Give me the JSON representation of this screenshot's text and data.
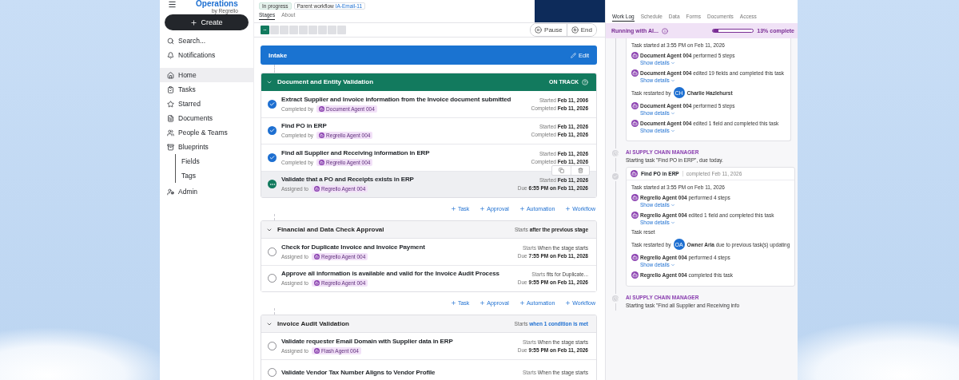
{
  "sidebar": {
    "logo": {
      "title": "Operations",
      "byline": "by Regrello"
    },
    "create_button": "Create",
    "top_items": [
      {
        "label": "Search..."
      },
      {
        "label": "Notifications"
      }
    ],
    "items": [
      {
        "label": "Home",
        "selected": true
      },
      {
        "label": "Tasks",
        "selected": false
      },
      {
        "label": "Starred",
        "selected": false
      },
      {
        "label": "Documents",
        "selected": false
      },
      {
        "label": "People & Teams",
        "selected": false
      },
      {
        "label": "Blueprints",
        "selected": false,
        "children": [
          {
            "label": "Fields",
            "selected": false
          },
          {
            "label": "Tags",
            "selected": false
          }
        ]
      },
      {
        "label": "Admin",
        "selected": false
      }
    ]
  },
  "header": {
    "badges": [
      {
        "kind": "status",
        "text": "In progress"
      },
      {
        "kind": "parent",
        "text": "Parent workflow",
        "link": "IA-Email-11"
      }
    ],
    "tabs": [
      {
        "label": "Stages",
        "selected": true
      },
      {
        "label": "About",
        "selected": false
      }
    ],
    "stage_steps": [
      {
        "selected": true
      },
      {
        "selected": false
      },
      {
        "selected": false
      },
      {
        "selected": false
      },
      {
        "selected": false
      },
      {
        "selected": false
      },
      {
        "selected": false
      },
      {
        "selected": false
      },
      {
        "selected": false
      }
    ],
    "buttons": [
      {
        "kind": "pause",
        "label": "Pause"
      },
      {
        "kind": "end",
        "label": "End"
      }
    ]
  },
  "intake": {
    "title": "Intake",
    "edit": "Edit"
  },
  "stages": [
    {
      "title": "Document and Entity Validation",
      "active": true,
      "badge": "ON TRACK",
      "add_actions": [
        "Task",
        "Approval",
        "Automation",
        "Workflow"
      ],
      "tasks": [
        {
          "title": "Extract Supplier and Invoice information from the Invoice document submitted",
          "kind": "check",
          "checked": true,
          "hovered": false,
          "who_label": "Completed by",
          "agent": "Document Agent 004",
          "line1_label": "Started",
          "line1_value": "Feb 11, 2006",
          "line2_label": "Completed",
          "line2_value": "Feb 11, 2026"
        },
        {
          "title": "Find PO in ERP",
          "kind": "check",
          "checked": true,
          "hovered": false,
          "who_label": "Completed by",
          "agent": "Regrello Agent 004",
          "line1_label": "Started",
          "line1_value": "Feb 11, 2026",
          "line2_label": "Completed",
          "line2_value": "Feb 11, 2026"
        },
        {
          "title": "Find all Supplier and Receiving information in ERP",
          "kind": "check",
          "checked": true,
          "hovered": false,
          "who_label": "Completed by",
          "agent": "Regrello Agent 004",
          "line1_label": "Started",
          "line1_value": "Feb 11, 2026",
          "line2_label": "Completed",
          "line2_value": "Feb 11, 2026"
        },
        {
          "title": "Validate that a PO and Receipts exists in ERP",
          "kind": "progress",
          "hovered": true,
          "who_label": "Assigned to",
          "agent": "Regrello Agent 004",
          "line1_label": "Started",
          "line1_value": "Feb 11, 2026",
          "line2_label": "Due",
          "line2_value": "6:55 PM on Feb 11, 2026"
        }
      ]
    },
    {
      "title": "Financial and Data Check Approval",
      "active": false,
      "starts": {
        "label": "Starts",
        "value": "after the previous stage",
        "link": false
      },
      "add_actions": [
        "Task",
        "Approval",
        "Automation",
        "Workflow"
      ],
      "tasks": [
        {
          "title": "Check for Duplicate Invoice and Invoice Payment",
          "kind": "check",
          "checked": false,
          "hovered": false,
          "who_label": "Assigned to",
          "agent": "Regrello Agent 004",
          "line1_label": "Starts",
          "line1_value": "When the stage starts",
          "line2_label": "Due",
          "line2_value": "7:55 PM on Feb 11, 2028"
        },
        {
          "title": "Approve all information is available and valid for the Invoice Audit Process",
          "kind": "check",
          "checked": false,
          "hovered": false,
          "who_label": "Assigned to",
          "agent": "Regrello Agent 004",
          "line1_label": "Starts",
          "line1_value": "fits for Duplicate...",
          "line2_label": "Due",
          "line2_value": "9:55 PM on Feb 11, 2026"
        }
      ]
    },
    {
      "title": "Invoice Audit Validation",
      "active": false,
      "starts": {
        "label": "Starts",
        "value": "when 1 condition is met",
        "link": true
      },
      "tasks": [
        {
          "title": "Validate requester Email Domain with Supplier data in ERP",
          "kind": "check",
          "checked": false,
          "hovered": false,
          "who_label": "Assigned to",
          "agent": "Flash Agent 004",
          "line1_label": "Starts",
          "line1_value": "When the stage starts",
          "line2_label": "Due",
          "line2_value": "9:55 PM on Feb 11, 2026"
        },
        {
          "title": "Validate Vendor Tax Number Aligns to Vendor Profile",
          "kind": "check",
          "checked": false,
          "hovered": false,
          "line1_label": "Starts",
          "line1_value": "When the stage starts"
        }
      ]
    }
  ],
  "worklog": {
    "tabs": [
      {
        "label": "Work Log",
        "selected": true
      },
      {
        "label": "Schedule",
        "selected": false
      },
      {
        "label": "Data",
        "selected": false
      },
      {
        "label": "Forms",
        "selected": false
      },
      {
        "label": "Documents",
        "selected": false
      },
      {
        "label": "Access",
        "selected": false
      }
    ],
    "ai_bar": {
      "label": "Running with AI...",
      "level": 0.13,
      "reading": "13% complete"
    },
    "entries": [
      {
        "kind": "card",
        "completed": false,
        "lines": [
          {
            "kind": "text",
            "text": "Task started at 3:55 PM on Feb 11, 2026"
          },
          {
            "kind": "agent",
            "actor": "Document Agent 004",
            "text": "performed 5 steps",
            "details": "Show details"
          },
          {
            "kind": "agent",
            "actor": "Document Agent 004",
            "text": "edited 19 fields and completed this task",
            "details": "Show details"
          },
          {
            "kind": "user",
            "text": "Task restarted by",
            "initials": "CH",
            "actor": "Charlie Hazlehurst"
          },
          {
            "kind": "agent",
            "actor": "Document Agent 004",
            "text": "performed 5 steps",
            "details": "Show details"
          },
          {
            "kind": "agent",
            "actor": "Document Agent 004",
            "text": "edited 1 field and completed this task",
            "details": "Show details"
          }
        ]
      },
      {
        "kind": "event",
        "title": "AI SUPPLY CHAIN MANAGER",
        "text": "Starting task \"Find PO in ERP\", due today."
      },
      {
        "kind": "card",
        "completed": true,
        "header": {
          "title": "Find PO in ERP",
          "meta": "completed Feb 11, 2026"
        },
        "lines": [
          {
            "kind": "text",
            "text": "Task started at 3:55 PM on Feb 11, 2026"
          },
          {
            "kind": "agent",
            "actor": "Regrello Agent 004",
            "text": "performed 4 steps",
            "details": "Show details"
          },
          {
            "kind": "agent",
            "actor": "Regrello Agent 004",
            "text": "edited 1 field and completed this task",
            "details": "Show details"
          },
          {
            "kind": "text",
            "text": "Task reset"
          },
          {
            "kind": "user",
            "text": "Task restarted by",
            "initials": "OA",
            "actor": "Owner Aria",
            "suffix": "due to previous task(s) updating"
          },
          {
            "kind": "agent",
            "actor": "Regrello Agent 004",
            "text": "performed 4 steps",
            "details": "Show details"
          },
          {
            "kind": "agent",
            "actor": "Regrello Agent 004",
            "text": "completed this task"
          }
        ]
      },
      {
        "kind": "event",
        "title": "AI SUPPLY CHAIN MANAGER",
        "text": "Starting task \"Find all Supplier and Receiving info"
      }
    ]
  }
}
